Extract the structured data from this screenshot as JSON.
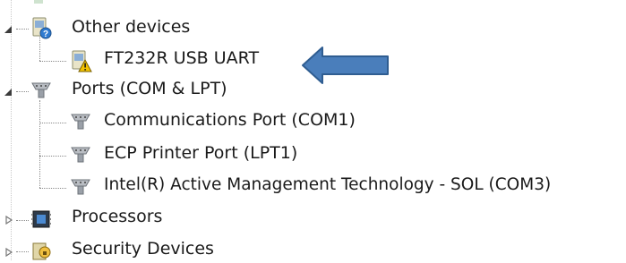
{
  "tree": {
    "other_devices": {
      "label": "Other devices",
      "expanded": true,
      "icon": "unknown-device-icon"
    },
    "ft232r": {
      "label": "FT232R USB UART",
      "icon": "warning-device-icon"
    },
    "ports": {
      "label": "Ports (COM & LPT)",
      "expanded": true,
      "icon": "port-connector-icon"
    },
    "com1": {
      "label": "Communications Port (COM1)",
      "icon": "port-connector-icon"
    },
    "lpt1": {
      "label": "ECP Printer Port (LPT1)",
      "icon": "port-connector-icon"
    },
    "com3": {
      "label": "Intel(R) Active Management Technology - SOL (COM3)",
      "icon": "port-connector-icon"
    },
    "processors": {
      "label": "Processors",
      "expanded": false,
      "icon": "processor-icon"
    },
    "security": {
      "label": "Security Devices",
      "expanded": false,
      "icon": "security-device-icon"
    }
  },
  "colors": {
    "arrow_fill": "#4a7ebb",
    "arrow_stroke": "#2f5d91",
    "warning": "#f2c200"
  }
}
